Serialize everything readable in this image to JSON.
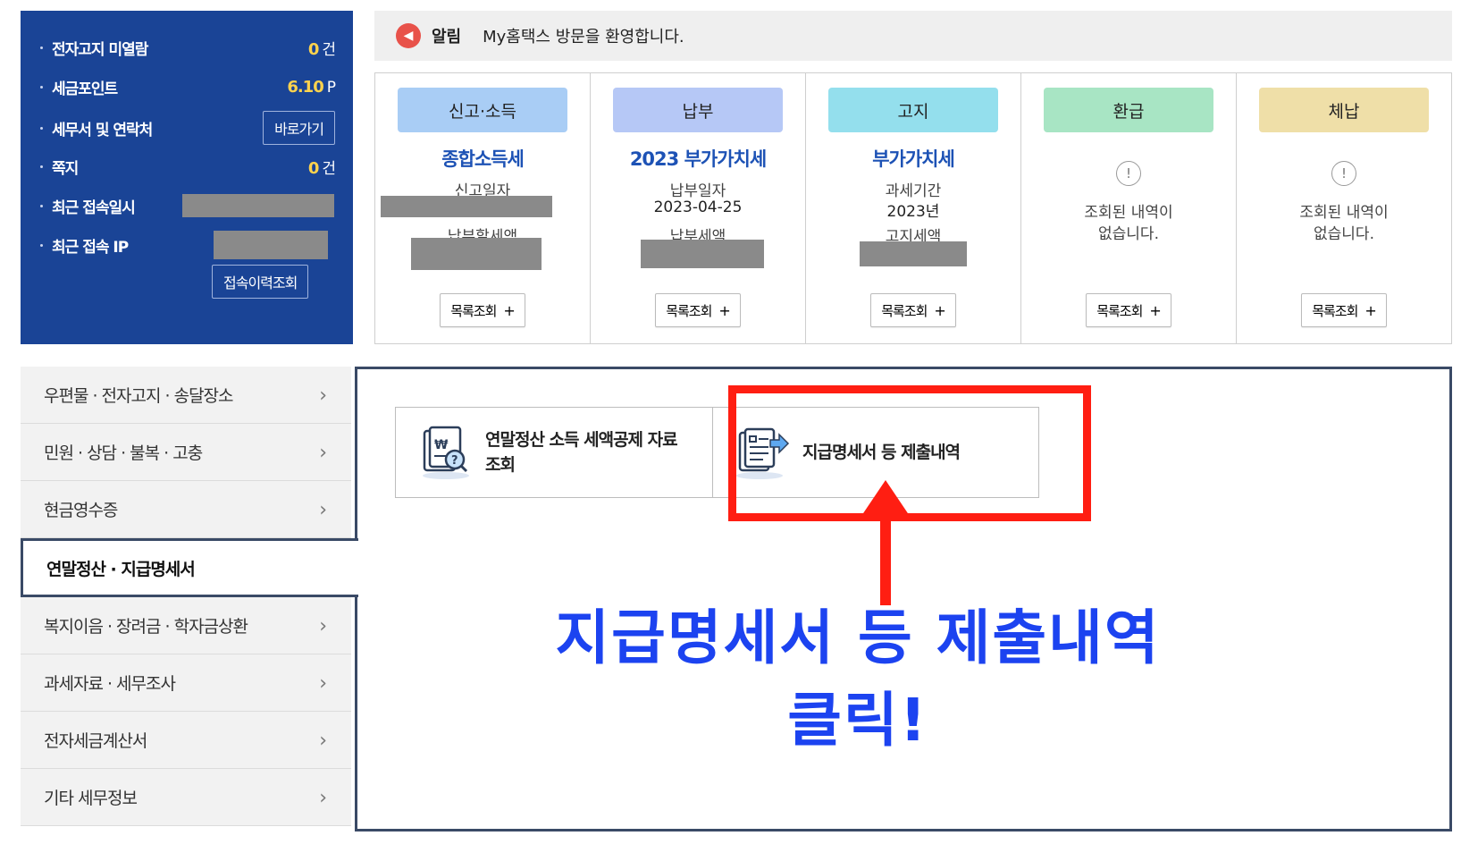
{
  "user_panel": {
    "rows": [
      {
        "label": "전자고지 미열람",
        "value": "0",
        "unit": "건"
      },
      {
        "label": "세금포인트",
        "value": "6.10",
        "unit": "P"
      },
      {
        "label": "세무서 및 연락처",
        "button": "바로가기"
      },
      {
        "label": "쪽지",
        "value": "0",
        "unit": "건"
      },
      {
        "label": "최근 접속일시"
      },
      {
        "label": "최근 접속 IP"
      }
    ],
    "history_button": "접속이력조회"
  },
  "notice": {
    "title": "알림",
    "message": "My홈택스 방문을 환영합니다."
  },
  "cards": [
    {
      "header": "신고·소득",
      "header_color": "#a9cdf5",
      "main": "종합소득세",
      "sub1": "신고일자",
      "sub2": "납부할세액",
      "button": "목록조회"
    },
    {
      "header": "납부",
      "header_color": "#b6c8f6",
      "main": "2023 부가가치세",
      "sub1": "납부일자",
      "date": "2023-04-25",
      "sub2": "납부세액",
      "button": "목록조회"
    },
    {
      "header": "고지",
      "header_color": "#94dfed",
      "main": "부가가치세",
      "sub1": "과세기간",
      "date": "2023년",
      "sub2": "고지세액",
      "button": "목록조회"
    },
    {
      "header": "환급",
      "header_color": "#a8e5c4",
      "empty_line1": "조회된 내역이",
      "empty_line2": "없습니다.",
      "button": "목록조회"
    },
    {
      "header": "체납",
      "header_color": "#efdfa8",
      "empty_line1": "조회된 내역이",
      "empty_line2": "없습니다.",
      "button": "목록조회"
    }
  ],
  "side_menu": [
    "우편물 · 전자고지 · 송달장소",
    "민원 · 상담 · 불복 · 고충",
    "현금영수증",
    "연말정산 · 지급명세서",
    "복지이음 · 장려금 · 학자금상환",
    "과세자료 · 세무조사",
    "전자세금계산서",
    "기타 세무정보"
  ],
  "tiles": {
    "deduction": {
      "line1": "연말정산 소득 세액공제 자료",
      "line2": "조회",
      "icon": "document-search-icon"
    },
    "submission": {
      "label": "지급명세서 등 제출내역",
      "icon": "document-send-icon"
    }
  },
  "annotation": {
    "line1": "지급명세서 등 제출내역",
    "line2": "클릭!",
    "highlight_color": "#ff1e12",
    "text_color": "#1c43f0"
  }
}
